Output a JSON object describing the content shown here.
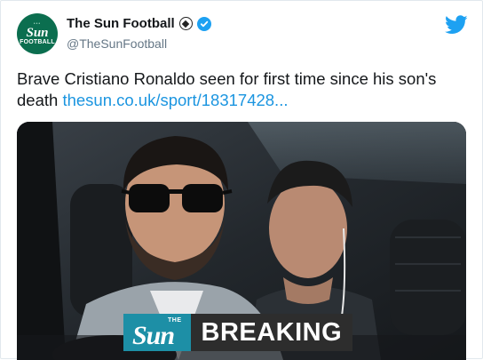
{
  "account": {
    "name": "The Sun Football",
    "handle": "@TheSunFootball",
    "avatar_logo_word": "Sun",
    "avatar_logo_sub": "FOOTBALL"
  },
  "tweet": {
    "text": "Brave Cristiano Ronaldo seen for first time since his son's death ",
    "link_text": "thesun.co.uk/sport/18317428..."
  },
  "media": {
    "banner_brand_small": "THE",
    "banner_brand": "Sun",
    "banner_label": "BREAKING"
  },
  "icons": {
    "platform": "twitter-bird-icon",
    "verified": "verified-badge-icon",
    "emoji": "soccer-ball-icon"
  },
  "colors": {
    "brand_blue": "#1da1f2",
    "link": "#1b95e0",
    "sun_teal": "#1d8fa6",
    "avatar_green": "#0b6e4f"
  }
}
